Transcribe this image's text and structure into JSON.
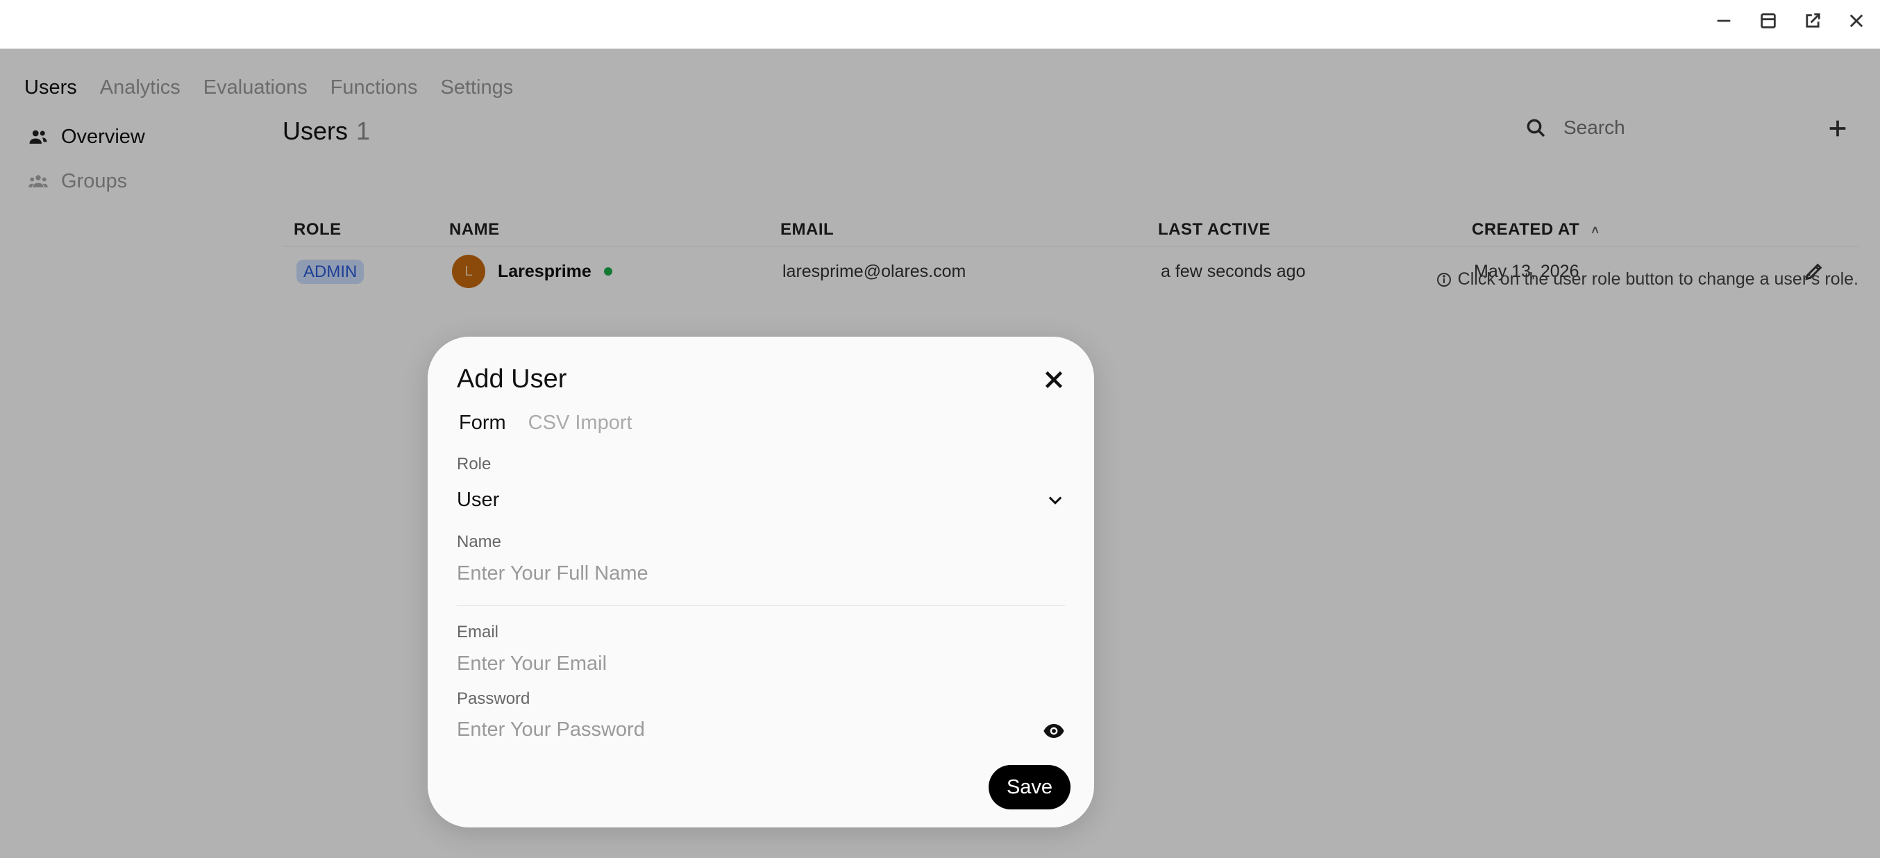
{
  "nav": {
    "tabs": [
      {
        "label": "Users"
      },
      {
        "label": "Analytics"
      },
      {
        "label": "Evaluations"
      },
      {
        "label": "Functions"
      },
      {
        "label": "Settings"
      }
    ]
  },
  "sidebar": {
    "items": [
      {
        "label": "Overview",
        "icon": "users-icon"
      },
      {
        "label": "Groups",
        "icon": "group-icon"
      }
    ]
  },
  "users": {
    "title": "Users",
    "count": "1",
    "search_placeholder": "Search",
    "columns": [
      "ROLE",
      "NAME",
      "EMAIL",
      "LAST ACTIVE",
      "CREATED AT"
    ],
    "sort_indicator": "˄",
    "rows": [
      {
        "role": "ADMIN",
        "avatar_initial": "L",
        "name": "Laresprime",
        "email": "laresprime@olares.com",
        "last_active": "a few seconds ago",
        "created_at": "May 13, 2026"
      }
    ],
    "hint": "Click on the user role button to change a user's role."
  },
  "modal": {
    "title": "Add User",
    "tabs": [
      {
        "label": "Form"
      },
      {
        "label": "CSV Import"
      }
    ],
    "role_label": "Role",
    "role_value": "User",
    "name_label": "Name",
    "name_placeholder": "Enter Your Full Name",
    "email_label": "Email",
    "email_placeholder": "Enter Your Email",
    "password_label": "Password",
    "password_placeholder": "Enter Your Password",
    "save_label": "Save"
  },
  "colors": {
    "accent": "#000000",
    "badge_bg": "#cfe0ff",
    "badge_text": "#2a5bd7",
    "avatar": "#c86a0f",
    "online": "#1fae4b"
  }
}
